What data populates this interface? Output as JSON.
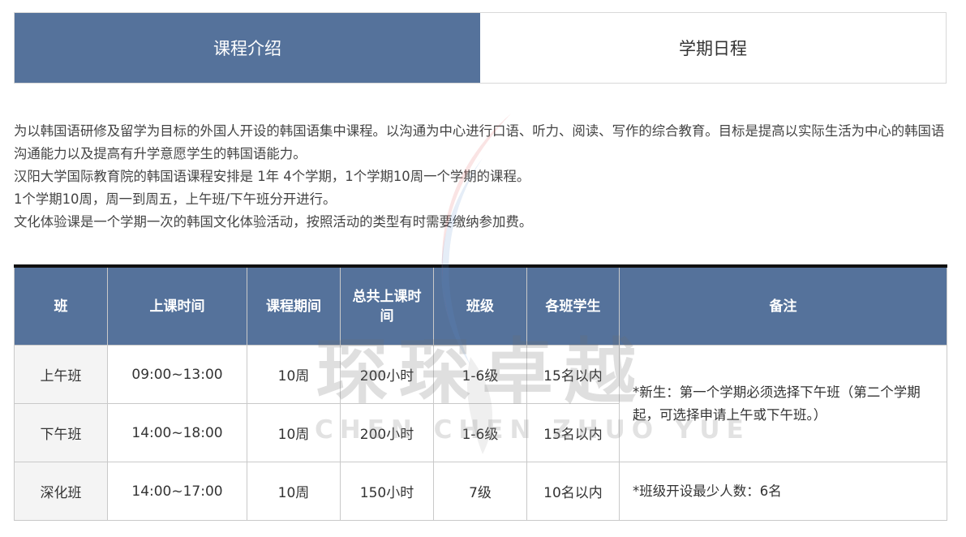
{
  "tabs": [
    {
      "label": "课程介绍",
      "active": true
    },
    {
      "label": "学期日程",
      "active": false
    }
  ],
  "intro": {
    "lines": [
      "为以韩国语研修及留学为目标的外国人开设的韩国语集中课程。以沟通为中心进行口语、听力、阅读、写作的综合教育。目标是提高以实际生活为中心的韩国语沟通能力以及提高有升学意愿学生的韩国语能力。",
      "汉阳大学国际教育院的韩国语课程安排是 1年 4个学期，1个学期10周一个学期的课程。",
      "1个学期10周，周一到周五，上午班/下午班分开进行。",
      "文化体验课是一个学期一次的韩国文化体验活动，按照活动的类型有时需要缴纳参加费。"
    ]
  },
  "watermark": {
    "text": "琛琛卓越",
    "sub": "CHEN CHEN ZHUO YUE"
  },
  "table": {
    "headers": [
      "班",
      "上课时间",
      "课程期间",
      "总共上课时间",
      "班级",
      "各班学生",
      "备注"
    ],
    "rows": [
      [
        "上午班",
        "09:00~13:00",
        "10周",
        "200小时",
        "1-6级",
        "15名以内"
      ],
      [
        "下午班",
        "14:00~18:00",
        "10周",
        "200小时",
        "1-6级",
        "15名以内"
      ],
      [
        "深化班",
        "14:00~17:00",
        "10周",
        "150小时",
        "7级",
        "10名以内"
      ]
    ],
    "notes": [
      "*新生：第一个学期必须选择下午班（第二个学期起，可选择申请上午或下午班。）",
      "*班级开设最少人数：6名"
    ]
  },
  "colors": {
    "header_bg": "#55729b",
    "accent_border": "#111111",
    "first_col_bg": "#f4f4f4"
  }
}
